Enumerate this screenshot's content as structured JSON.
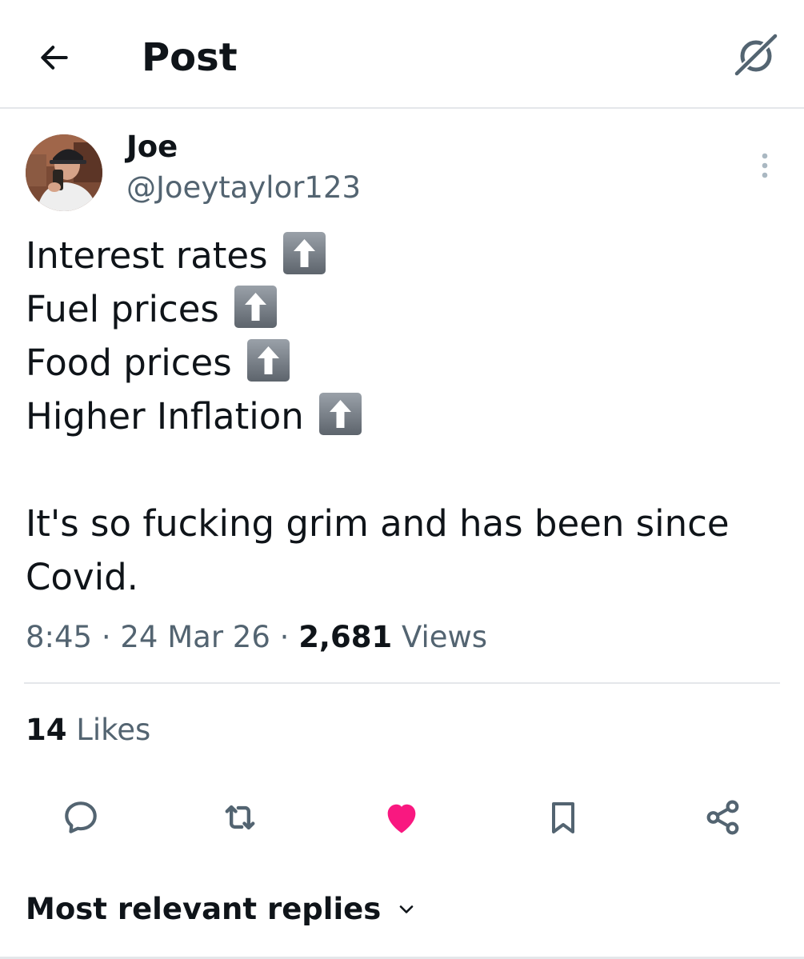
{
  "header": {
    "title": "Post",
    "back_icon": "arrow-left-icon",
    "grok_icon": "grok-icon"
  },
  "author": {
    "name": "Joe",
    "handle": "@Joeytaylor123",
    "avatar_icon": "avatar-photo"
  },
  "tweet": {
    "lines": [
      {
        "text": "Interest rates",
        "emoji": "up-arrow-emoji"
      },
      {
        "text": "Fuel prices",
        "emoji": "up-arrow-emoji"
      },
      {
        "text": "Food prices",
        "emoji": "up-arrow-emoji"
      },
      {
        "text": "Higher Inflation",
        "emoji": "up-arrow-emoji"
      }
    ],
    "closing": "It's so fucking grim and has been since Covid."
  },
  "meta": {
    "time": "8:45",
    "separator": "·",
    "date": "24 Mar 26",
    "views_count": "2,681",
    "views_label": "Views"
  },
  "likes": {
    "count": "14",
    "label": "Likes"
  },
  "actions": {
    "reply_icon": "reply-icon",
    "repost_icon": "repost-icon",
    "like_icon": "heart-filled-icon",
    "bookmark_icon": "bookmark-icon",
    "share_icon": "share-icon"
  },
  "replies": {
    "sort_label": "Most relevant replies"
  },
  "colors": {
    "text_primary": "#0f1419",
    "text_secondary": "#536471",
    "like_active": "#f91880",
    "divider": "#e4e7ea"
  }
}
